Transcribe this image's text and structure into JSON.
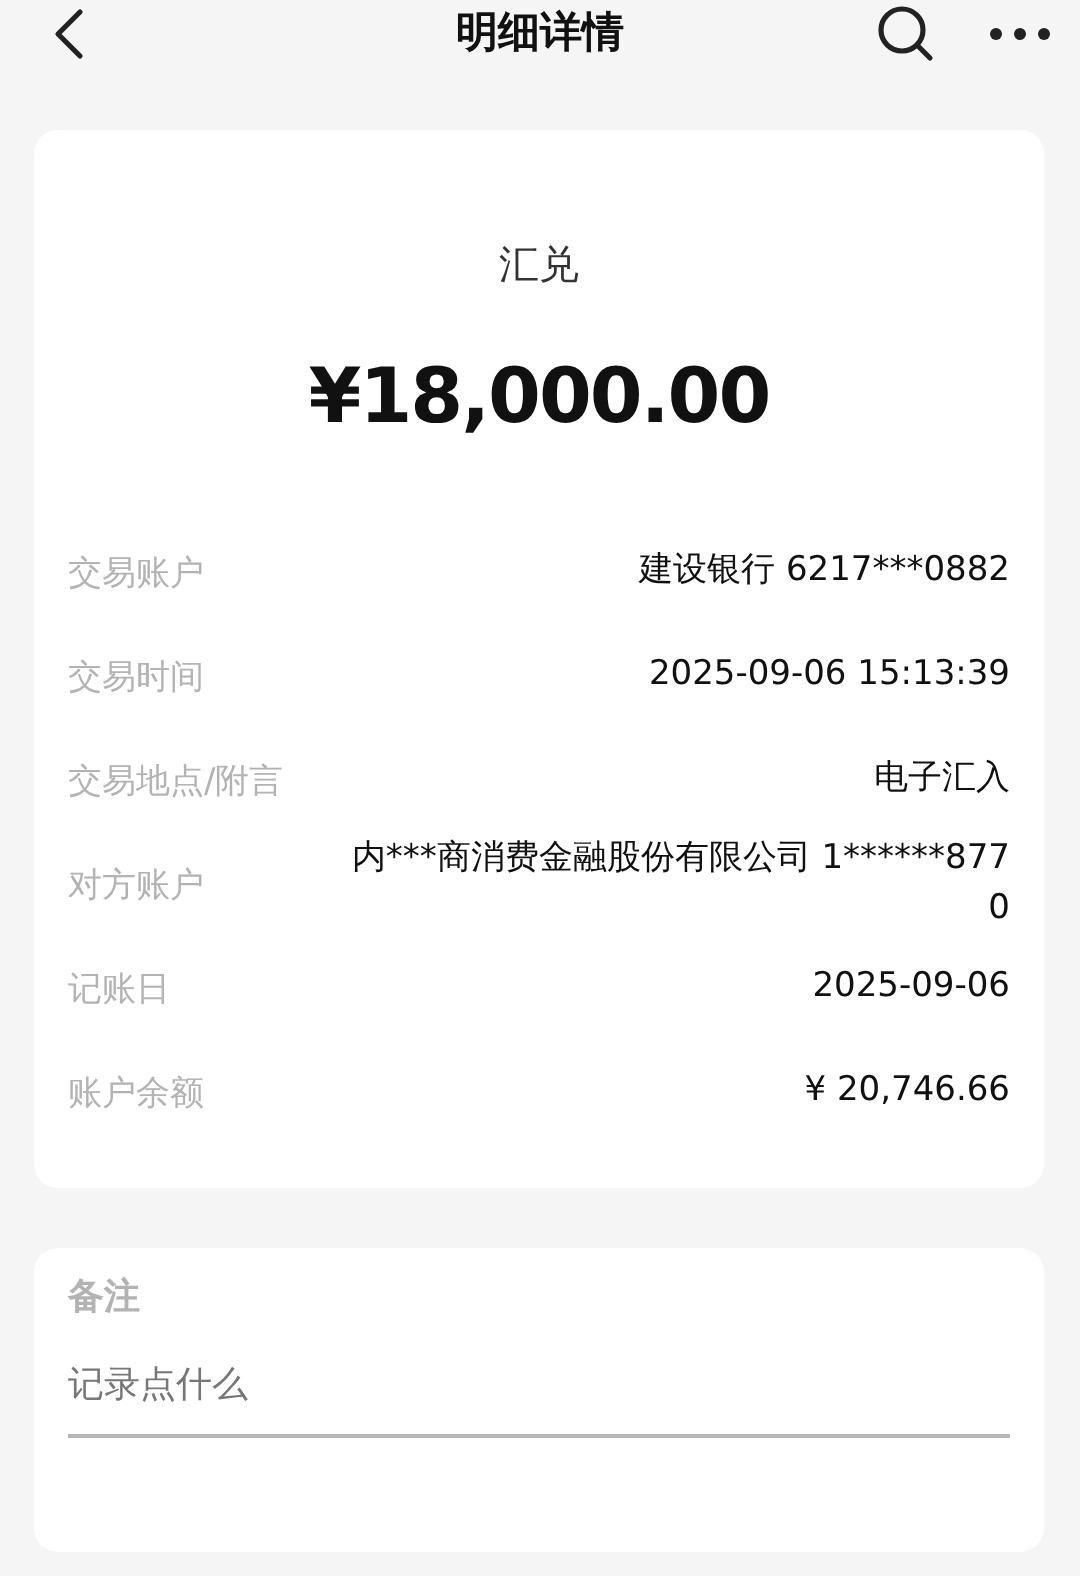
{
  "header": {
    "title": "明细详情"
  },
  "summary": {
    "type": "汇兑",
    "amount": "¥18,000.00"
  },
  "details": [
    {
      "label": "交易账户",
      "value": "建设银行 6217***0882"
    },
    {
      "label": "交易时间",
      "value": "2025-09-06 15:13:39"
    },
    {
      "label": "交易地点/附言",
      "value": "电子汇入"
    },
    {
      "label": "对方账户",
      "value": "内***商消费金融股份有限公司 1******8770"
    },
    {
      "label": "记账日",
      "value": "2025-09-06"
    },
    {
      "label": "账户余额",
      "value": "¥ 20,746.66"
    }
  ],
  "note": {
    "label": "备注",
    "placeholder": "记录点什么"
  }
}
